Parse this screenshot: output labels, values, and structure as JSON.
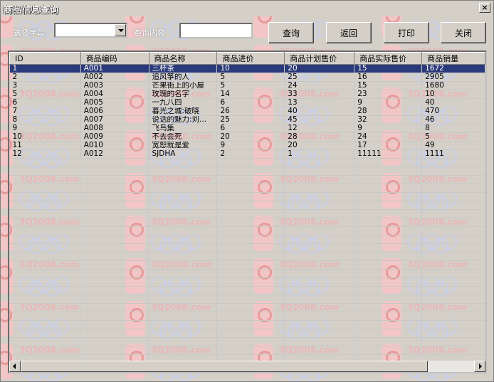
{
  "window": {
    "title": "商品信息查询",
    "close_symbol": "×"
  },
  "watermark": {
    "text": "3Q2008.com"
  },
  "search": {
    "field_label": "选择字段",
    "field_value": "",
    "content_label": "查询内容",
    "content_value": ""
  },
  "buttons": {
    "query": "查询",
    "back": "返回",
    "print": "打印",
    "close": "关闭"
  },
  "table": {
    "columns": [
      "ID",
      "商品编码",
      "商品名称",
      "商品进价",
      "商品计划售价",
      "商品实际售价",
      "商品销量"
    ],
    "selected_row": 0,
    "rows": [
      [
        "1",
        "A001",
        "三杯茶",
        "10",
        "20",
        "15",
        "1672"
      ],
      [
        "2",
        "A002",
        "追风筝的人",
        "5",
        "25",
        "16",
        "2905"
      ],
      [
        "3",
        "A003",
        "芒果街上的小屋",
        "5",
        "24",
        "15",
        "1680"
      ],
      [
        "5",
        "A004",
        "玫瑰的名字",
        "14",
        "33",
        "23",
        "10"
      ],
      [
        "6",
        "A005",
        "一九八四",
        "6",
        "13",
        "9",
        "40"
      ],
      [
        "7",
        "A006",
        "暮光之城:破晓",
        "26",
        "40",
        "28",
        "470"
      ],
      [
        "8",
        "A007",
        "说话的魅力:刘...",
        "25",
        "45",
        "32",
        "46"
      ],
      [
        "9",
        "A008",
        "飞鸟集",
        "6",
        "12",
        "9",
        "8"
      ],
      [
        "10",
        "A009",
        "不去会死",
        "20",
        "28",
        "24",
        "5"
      ],
      [
        "11",
        "A010",
        "宽恕就是爱",
        "9",
        "20",
        "17",
        "49"
      ],
      [
        "12",
        "A012",
        "SJDHA",
        "2",
        "1",
        "11111",
        "1111"
      ]
    ]
  }
}
